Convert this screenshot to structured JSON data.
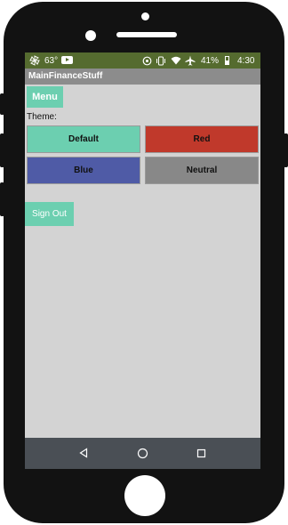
{
  "status_bar": {
    "temperature": "63°",
    "battery_percent": "41%",
    "time": "4:30",
    "icons": [
      "pinwheel-icon",
      "youtube-icon",
      "data-saver-icon",
      "vibrate-icon",
      "wifi-icon",
      "airplane-icon",
      "battery-icon"
    ]
  },
  "app": {
    "title": "MainFinanceStuff"
  },
  "menu": {
    "label": "Menu"
  },
  "theme": {
    "label": "Theme:",
    "options": [
      "Default",
      "Red",
      "Blue",
      "Neutral"
    ]
  },
  "sign_out": {
    "label": "Sign Out"
  },
  "colors": {
    "status_bar": "#556b2f",
    "title_bar": "#8c8c8c",
    "background": "#d3d3d3",
    "accent": "#6ccfb0",
    "red": "#c0392b",
    "blue": "#4f5ba6",
    "neutral": "#888888",
    "nav_bar": "#4a4f55"
  },
  "nav_bar": {
    "icons": [
      "back-icon",
      "home-icon",
      "recents-icon"
    ]
  }
}
